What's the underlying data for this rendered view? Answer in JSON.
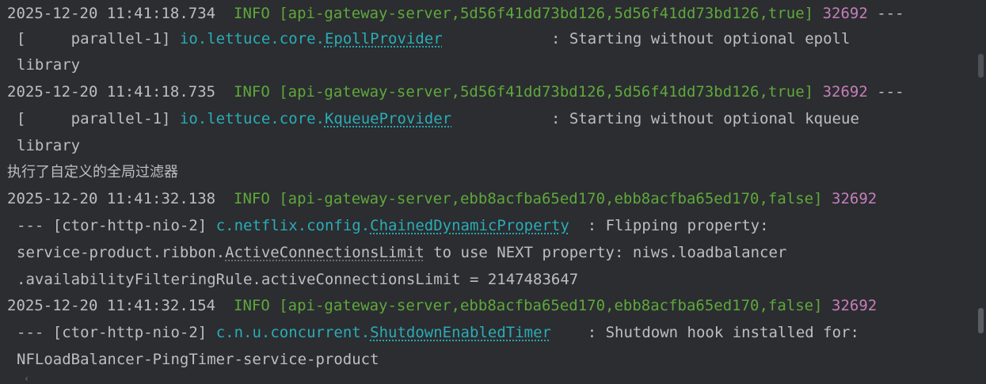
{
  "log": {
    "entry1": {
      "timestamp": "2025-12-20 11:41:18.734",
      "level": "INFO",
      "context": "[api-gateway-server,5d56f41dd73bd126,5d56f41dd73bd126,true]",
      "pid": "32692",
      "dashes": "---",
      "thread": "[     parallel-1]",
      "package": "io.lettuce.core.",
      "class": "EpollProvider",
      "message": ": Starting without optional epoll",
      "message_cont": "library"
    },
    "entry2": {
      "timestamp": "2025-12-20 11:41:18.735",
      "level": "INFO",
      "context": "[api-gateway-server,5d56f41dd73bd126,5d56f41dd73bd126,true]",
      "pid": "32692",
      "dashes": "---",
      "thread": "[     parallel-1]",
      "package": "io.lettuce.core.",
      "class": "KqueueProvider",
      "message": ": Starting without optional kqueue",
      "message_cont": "library"
    },
    "plain_line": "执行了自定义的全局过滤器",
    "entry3": {
      "timestamp": "2025-12-20 11:41:32.138",
      "level": "INFO",
      "context": "[api-gateway-server,ebb8acfba65ed170,ebb8acfba65ed170,false]",
      "pid": "32692",
      "dashes": "---",
      "thread": "[ctor-http-nio-2]",
      "package": "c.netflix.config.",
      "class": "ChainedDynamicProperty",
      "message": ": Flipping property:",
      "message_cont_a": "service-product.ribbon.",
      "message_cont_b": "ActiveConnectionsLimit",
      "message_cont_c": " to use NEXT property: niws.loadbalancer",
      "message_cont2": ".availabilityFilteringRule.activeConnectionsLimit = 2147483647"
    },
    "entry4": {
      "timestamp": "2025-12-20 11:41:32.154",
      "level": "INFO",
      "context": "[api-gateway-server,ebb8acfba65ed170,ebb8acfba65ed170,false]",
      "pid": "32692",
      "dashes": "---",
      "thread": "[ctor-http-nio-2]",
      "package": "c.n.u.concurrent.",
      "class": "ShutdownEnabledTimer",
      "message": ": Shutdown hook installed for:",
      "message_cont": "NFLoadBalancer-PingTimer-service-product"
    }
  },
  "colors": {
    "background": "#2b2d30",
    "default_text": "#bcbec4",
    "level_and_context": "#5fa83c",
    "pid": "#c77dbb",
    "logger": "#2aacb8"
  },
  "icons": {
    "scroll_left": "chevron-left"
  }
}
